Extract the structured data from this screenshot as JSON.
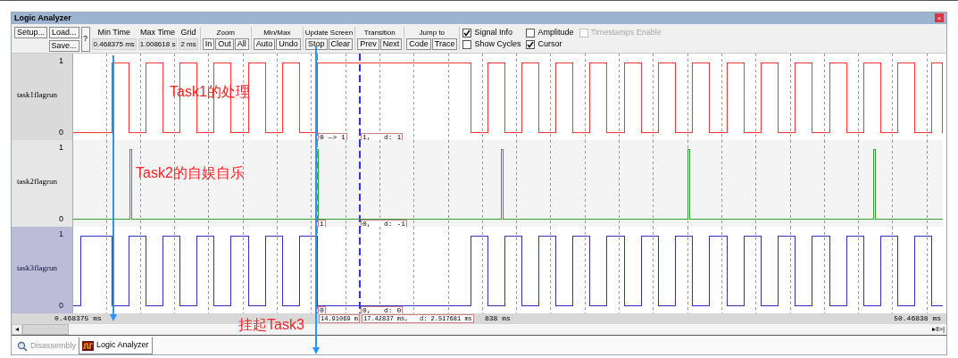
{
  "window": {
    "title": "Logic Analyzer",
    "close": "×"
  },
  "toolbar": {
    "file_buttons": [
      "Setup...",
      "Load...",
      "Save..."
    ],
    "help": "?",
    "fields": [
      {
        "label": "Min Time",
        "value": "0.468375 ms"
      },
      {
        "label": "Max Time",
        "value": "1.008618 s"
      },
      {
        "label": "Grid",
        "value": "2 ms"
      }
    ],
    "groups": [
      {
        "label": "Zoom",
        "buttons": [
          "In",
          "Out",
          "All"
        ]
      },
      {
        "label": "Min/Max",
        "buttons": [
          "Auto",
          "Undo"
        ]
      },
      {
        "label": "Update Screen",
        "buttons": [
          "Stop",
          "Clear"
        ]
      },
      {
        "label": "Transition",
        "buttons": [
          "Prev",
          "Next"
        ]
      },
      {
        "label": "Jump to",
        "buttons": [
          "Code",
          "Trace"
        ]
      }
    ],
    "checkboxes": [
      {
        "label": "Signal Info",
        "checked": true,
        "disabled": false
      },
      {
        "label": "Show Cycles",
        "checked": false,
        "disabled": false
      },
      {
        "label": "Amplitude",
        "checked": false,
        "disabled": false
      },
      {
        "label": "Cursor",
        "checked": true,
        "disabled": false
      },
      {
        "label": "Timestamps Enable",
        "checked": false,
        "disabled": true
      }
    ]
  },
  "signals": [
    {
      "name": "task1flagrun",
      "kind": "square",
      "color": "#ff3333",
      "selected": false,
      "high": "1",
      "low": "0",
      "readouts": [
        "0 —> 1",
        "1,   d: 1"
      ]
    },
    {
      "name": "task2flagrun",
      "kind": "spike",
      "color": "#33a033",
      "selected": false,
      "high": "1",
      "low": "0",
      "readouts": [
        "1",
        "0,   d: -1"
      ]
    },
    {
      "name": "task3flagrun",
      "kind": "inverse",
      "color": "#3333bb",
      "selected": true,
      "high": "1",
      "low": "0",
      "readouts": [
        "0",
        "0,   d: 0"
      ]
    }
  ],
  "time_axis": {
    "start": "0.468375 ms",
    "readouts": [
      "14.91069 m",
      "17.42837 ms,   d: 2.517681 ms"
    ],
    "partial": "838 ms",
    "end": "50.46838 ms"
  },
  "scrollbar": {
    "left": "◂",
    "right": "▸‖>|"
  },
  "annotations": [
    "Task1的处理",
    "Task2的自娱自乐",
    "挂起Task3"
  ],
  "tabs": [
    {
      "label": "Disassembly",
      "selected": false
    },
    {
      "label": "Logic Analyzer",
      "selected": true
    }
  ]
}
